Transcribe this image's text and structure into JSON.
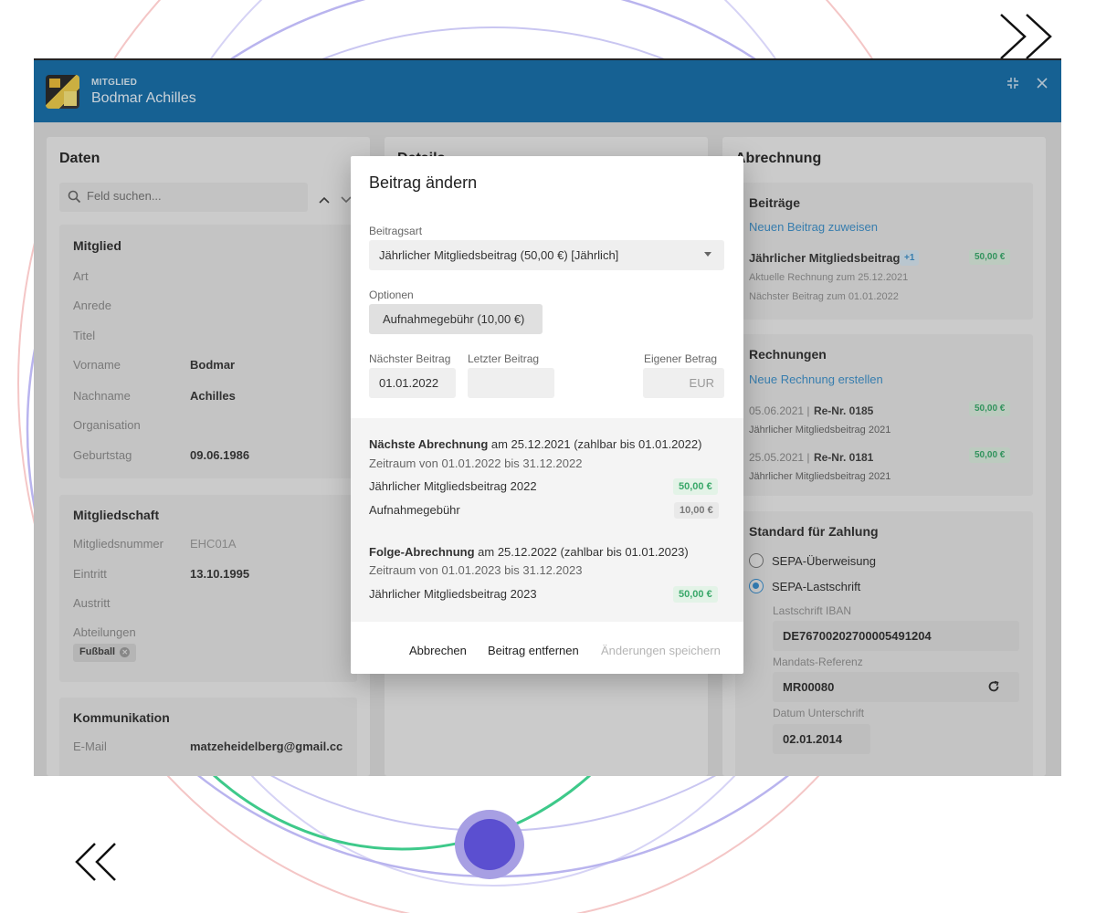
{
  "header": {
    "overline": "MITGLIED",
    "title": "Bodmar Achilles"
  },
  "icons": {
    "shrink": "shrink-icon",
    "close": "close-icon",
    "search": "search-icon",
    "chevron_up": "chevron-up-icon",
    "chevron_down": "chevron-down-icon",
    "refresh": "refresh-icon",
    "next": "chevron-right-double-icon",
    "prev": "chevron-left-double-icon"
  },
  "colors": {
    "appbar": "#1a6fa8",
    "accent": "#3b8fcf",
    "positive": "#3aa86a"
  },
  "daten": {
    "title": "Daten",
    "search_placeholder": "Feld suchen...",
    "mitglied": {
      "title": "Mitglied",
      "rows": [
        {
          "label": "Art",
          "value": ""
        },
        {
          "label": "Anrede",
          "value": ""
        },
        {
          "label": "Titel",
          "value": ""
        },
        {
          "label": "Vorname",
          "value": "Bodmar"
        },
        {
          "label": "Nachname",
          "value": "Achilles"
        },
        {
          "label": "Organisation",
          "value": ""
        },
        {
          "label": "Geburtstag",
          "value": "09.06.1986"
        }
      ]
    },
    "mitgliedschaft": {
      "title": "Mitgliedschaft",
      "rows": [
        {
          "label": "Mitgliedsnummer",
          "value": "EHC01A"
        },
        {
          "label": "Eintritt",
          "value": "13.10.1995"
        },
        {
          "label": "Austritt",
          "value": ""
        },
        {
          "label": "Abteilungen",
          "value": ""
        }
      ],
      "tag": "Fußball"
    },
    "kommunikation": {
      "title": "Kommunikation",
      "email_label": "E-Mail",
      "email_value": "matzeheidelberg@gmail.cc"
    }
  },
  "details": {
    "title": "Details"
  },
  "abrechnung": {
    "title": "Abrechnung",
    "beitraege": {
      "title": "Beiträge",
      "link": "Neuen Beitrag zuweisen",
      "item_name": "Jährlicher Mitgliedsbeitrag",
      "item_extra": "+1",
      "item_amount": "50,00 €",
      "line1": "Aktuelle Rechnung zum 25.12.2021",
      "line2": "Nächster Beitrag zum 01.01.2022"
    },
    "rechnungen": {
      "title": "Rechnungen",
      "link": "Neue Rechnung erstellen",
      "items": [
        {
          "date": "05.06.2021 |",
          "nr": "Re-Nr. 0185",
          "desc": "Jährlicher Mitgliedsbeitrag 2021",
          "amount": "50,00 €"
        },
        {
          "date": "25.05.2021 |",
          "nr": "Re-Nr. 0181",
          "desc": "Jährlicher Mitgliedsbeitrag 2021",
          "amount": "50,00 €"
        }
      ]
    },
    "zahlung": {
      "title": "Standard für Zahlung",
      "option1": "SEPA-Überweisung",
      "option2": "SEPA-Lastschrift",
      "selected": "SEPA-Lastschrift",
      "iban_label": "Lastschrift IBAN",
      "iban_value": "DE76700202700005491204",
      "mandat_label": "Mandats-Referenz",
      "mandat_value": "MR00080",
      "datum_label": "Datum Unterschrift",
      "datum_value": "02.01.2014"
    }
  },
  "modal": {
    "title": "Beitrag ändern",
    "beitragsart_label": "Beitragsart",
    "beitragsart_value": "Jährlicher Mitgliedsbeitrag (50,00 €) [Jährlich]",
    "optionen_label": "Optionen",
    "option_chip": "Aufnahmegebühr (10,00 €)",
    "naechster_label": "Nächster Beitrag",
    "naechster_value": "01.01.2022",
    "letzter_label": "Letzter Beitrag",
    "letzter_value": "",
    "eigener_label": "Eigener Betrag",
    "eigener_suffix": "EUR",
    "next_billing": {
      "bold": "Nächste Abrechnung",
      "rest": " am 25.12.2021 (zahlbar bis 01.01.2022)",
      "period": "Zeitraum von 01.01.2022 bis 31.12.2022",
      "lines": [
        {
          "label": "Jährlicher Mitgliedsbeitrag 2022",
          "amount": "50,00 €",
          "kind": "green"
        },
        {
          "label": "Aufnahmegebühr",
          "amount": "10,00 €",
          "kind": "neutral"
        }
      ]
    },
    "follow_billing": {
      "bold": "Folge-Abrechnung",
      "rest": " am 25.12.2022 (zahlbar bis 01.01.2023)",
      "period": "Zeitraum von 01.01.2023 bis 31.12.2023",
      "lines": [
        {
          "label": "Jährlicher Mitgliedsbeitrag 2023",
          "amount": "50,00 €",
          "kind": "green"
        }
      ]
    },
    "buttons": {
      "cancel": "Abbrechen",
      "remove": "Beitrag entfernen",
      "save": "Änderungen speichern"
    }
  }
}
